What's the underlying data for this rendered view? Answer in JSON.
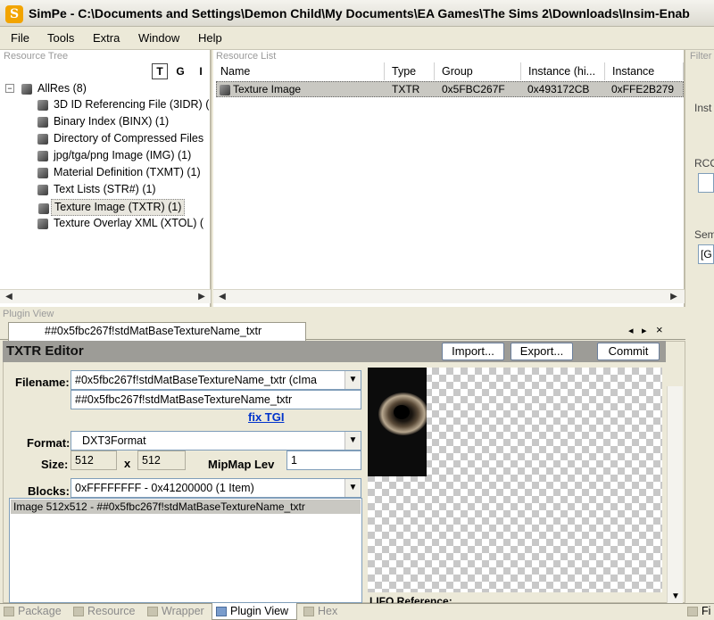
{
  "window": {
    "title": "SimPe - C:\\Documents and Settings\\Demon Child\\My Documents\\EA Games\\The Sims 2\\Downloads\\Insim-Enab"
  },
  "menu": [
    "File",
    "Tools",
    "Extra",
    "Window",
    "Help"
  ],
  "resource_tree": {
    "caption": "Resource Tree",
    "toggle_buttons": [
      "T",
      "G",
      "I"
    ],
    "root": "AllRes (8)",
    "items": [
      "3D ID Referencing File (3IDR) (",
      "Binary Index (BINX) (1)",
      "Directory of Compressed Files",
      "jpg/tga/png Image (IMG) (1)",
      "Material Definition (TXMT) (1)",
      "Text Lists (STR#) (1)",
      "Texture Image (TXTR) (1)",
      "Texture Overlay XML (XTOL) ("
    ]
  },
  "resource_list": {
    "caption": "Resource List",
    "columns": [
      "Name",
      "Type",
      "Group",
      "Instance (hi...",
      "Instance"
    ],
    "rows": [
      {
        "name": "Texture Image",
        "type": "TXTR",
        "group": "0x5FBC267F",
        "instance_hi": "0x493172CB",
        "instance": "0xFFE2B279"
      }
    ]
  },
  "filter_panel": {
    "caption": "Filter",
    "labels": [
      "Inst",
      "RCO",
      "Sem"
    ],
    "sem_value": "[G"
  },
  "plugin_view": {
    "caption": "Plugin View",
    "tab_label": "##0x5fbc267f!stdMatBaseTextureName_txtr",
    "nav_glyphs": [
      "◂",
      "▸",
      "×"
    ]
  },
  "txtr_editor": {
    "header": "TXTR Editor",
    "buttons": {
      "import": "Import...",
      "export": "Export...",
      "commit": "Commit"
    },
    "filename_label": "Filename:",
    "filename_dropdown": "#0x5fbc267f!stdMatBaseTextureName_txtr (cIma",
    "filename_value": "##0x5fbc267f!stdMatBaseTextureName_txtr",
    "fix_tgi": "fix TGI",
    "format_label": "Format:",
    "format_value": "DXT3Format",
    "size_label": "Size:",
    "size_w": "512",
    "size_x": "x",
    "size_h": "512",
    "mipmap_label": "MipMap Lev",
    "mipmap_value": "1",
    "blocks_label": "Blocks:",
    "blocks_value": "0xFFFFFFFF - 0x41200000 (1 Item)",
    "block_list": [
      "Image 512x512 - ##0x5fbc267f!stdMatBaseTextureName_txtr"
    ],
    "lifo_label": "LIFO Reference:"
  },
  "bottom_tabs": {
    "items": [
      "Package",
      "Resource",
      "Wrapper",
      "Plugin View",
      "Hex"
    ],
    "active": "Plugin View",
    "right_tab": "Fi"
  },
  "colors": {
    "selection": "#c9c8c2",
    "editor_header": "#9d9c97",
    "link": "#0033cc"
  }
}
